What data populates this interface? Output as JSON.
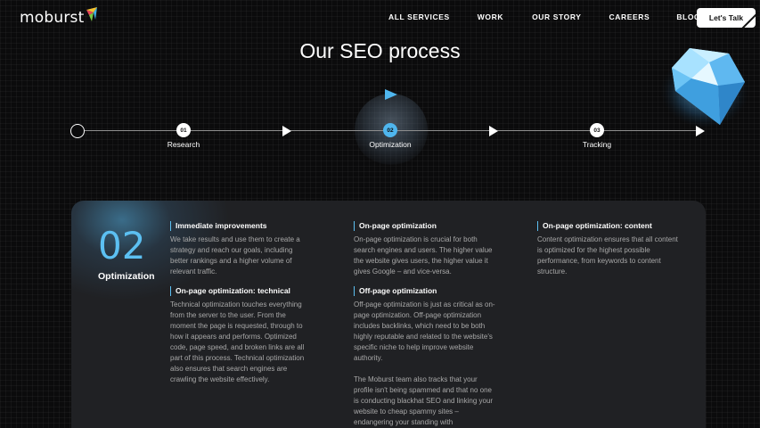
{
  "brand": {
    "name": "moburst"
  },
  "nav": {
    "items": [
      "ALL SERVICES",
      "WORK",
      "OUR STORY",
      "CAREERS",
      "BLOG"
    ],
    "cta": "Let's Talk"
  },
  "page": {
    "title": "Our SEO process"
  },
  "timeline": {
    "steps": [
      {
        "num": "01",
        "label": "Research"
      },
      {
        "num": "02",
        "label": "Optimization",
        "active": true
      },
      {
        "num": "03",
        "label": "Tracking"
      }
    ]
  },
  "panel": {
    "number": "02",
    "name": "Optimization",
    "blocks": [
      {
        "title": "Immediate improvements",
        "text": "We take results and use them to create a strategy and reach our goals, including better rankings and a higher volume of relevant traffic."
      },
      {
        "title": "On-page optimization: technical",
        "text": "Technical optimization touches everything from the server to the user. From the moment the page is requested, through to how it appears and performs. Optimized code, page speed, and broken links are all part of this process. Technical optimization also ensures that search engines are crawling the website effectively."
      },
      {
        "title": "On-page optimization",
        "text": "On-page optimization is crucial for both search engines and users. The higher value the website gives users, the higher value it gives Google – and vice-versa."
      },
      {
        "title": "Off-page optimization",
        "text": "Off-page optimization is just as critical as on-page optimization. Off-page optimization includes backlinks, which need to be both highly reputable and related to the website's specific niche to help improve website authority.",
        "text2": "The Moburst team also tracks that your profile isn't being spammed and that no one is conducting blackhat SEO and linking your website to cheap spammy sites – endangering your standing with"
      },
      {
        "title": "On-page optimization: content",
        "text": "Content optimization ensures that all content is optimized for the highest possible performance, from keywords to content structure."
      }
    ]
  },
  "colors": {
    "accent": "#5cc0f2",
    "background": "#0b0b0c",
    "panel": "#202124"
  },
  "icons": [
    "logo-flag-icon",
    "diamond-icon",
    "arrow-right-icon"
  ]
}
